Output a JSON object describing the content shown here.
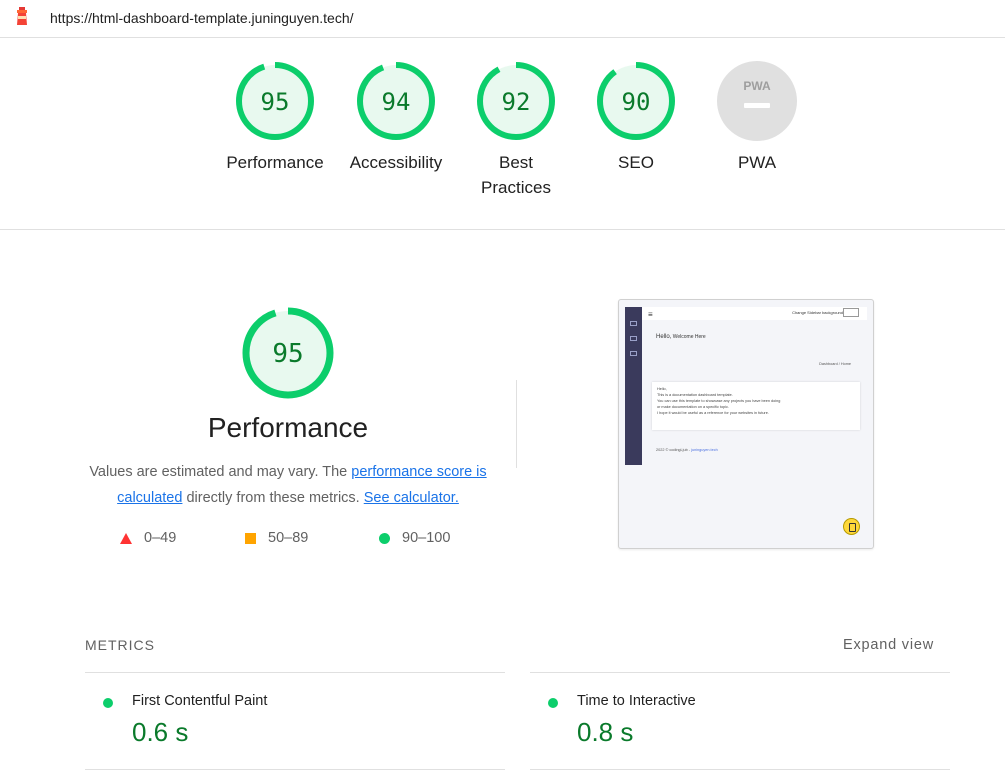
{
  "header": {
    "url": "https://html-dashboard-template.juninguyen.tech/"
  },
  "colors": {
    "pass": "#0cce6b",
    "pass_text": "#0a7a2b",
    "average": "#ffa400",
    "fail": "#ff3333",
    "link": "#1a73e8",
    "na": "#e0e0e0"
  },
  "gauges": [
    {
      "score": "95",
      "label": "Performance",
      "fraction": 0.95
    },
    {
      "score": "94",
      "label": "Accessibility",
      "fraction": 0.94
    },
    {
      "score": "92",
      "label": "Best Practices",
      "fraction": 0.92
    },
    {
      "score": "90",
      "label": "SEO",
      "fraction": 0.9
    },
    {
      "score": "",
      "label": "PWA",
      "badge": "PWA"
    }
  ],
  "performance": {
    "score": "95",
    "fraction": 0.95,
    "title": "Performance",
    "desc_prefix": "Values are estimated and may vary. The ",
    "desc_link1": "performance score is calculated",
    "desc_middle": " directly from these metrics. ",
    "desc_link2": "See calculator."
  },
  "legend": [
    {
      "range": "0–49",
      "shape": "triangle"
    },
    {
      "range": "50–89",
      "shape": "square"
    },
    {
      "range": "90–100",
      "shape": "circle"
    }
  ],
  "screenshot": {
    "menu_icon": "≡",
    "change_label": "Change Sidebar background",
    "hello": "Hello,",
    "welcome": " Welcome Here",
    "breadcrumb": "Dashboard  /  Home",
    "card_lines": [
      "Hello,",
      "This is a documentation dashboard template.",
      "You can use this template to showcase any projects you have been doing",
      "or make documentation on a specific topic.",
      "I hope it would be useful as a reference for your websites in future."
    ],
    "footer_prefix": "2022 © codingLjub - ",
    "footer_link": "juninguyen.tech"
  },
  "metrics": {
    "heading": "METRICS",
    "expand_label": "Expand view",
    "items": [
      {
        "name": "First Contentful Paint",
        "value": "0.6 s"
      },
      {
        "name": "Time to Interactive",
        "value": "0.8 s"
      }
    ]
  }
}
